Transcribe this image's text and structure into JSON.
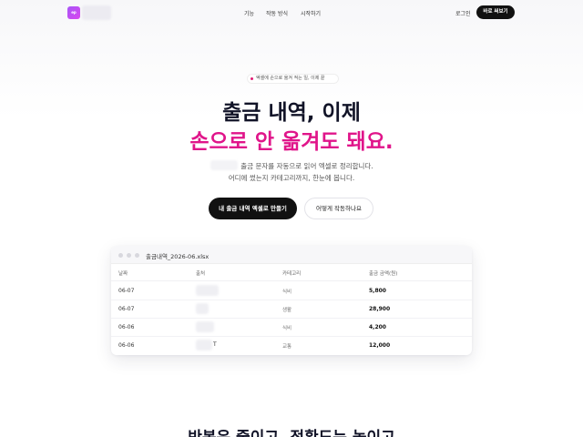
{
  "header": {
    "logo_text": "ep",
    "nav": [
      "기능",
      "작동 방식",
      "시작하기"
    ],
    "login": "로그인",
    "cta": "바로 써보기"
  },
  "hero": {
    "badge": "엑셀에 손으로 옮겨 적는 일, 이제 끝",
    "title_line1": "출금 내역, 이제",
    "title_line2": "손으로 안 옮겨도 돼요.",
    "sub_line1": "출금 문자를 자동으로 읽어 엑셀로 정리합니다.",
    "sub_line2": "어디에 썼는지 카테고리까지, 한눈에 봅니다.",
    "primary_button": "내 출금 내역 엑셀로 만들기",
    "secondary_button": "어떻게 작동하나요"
  },
  "sheet": {
    "filename": "출금내역_2026-06.xlsx",
    "columns": [
      "날짜",
      "출처",
      "카테고리",
      "출금 금액(원)"
    ],
    "rows": [
      {
        "date": "06-07",
        "category": "식비",
        "amount": "5,800",
        "tail": ""
      },
      {
        "date": "06-07",
        "category": "생활",
        "amount": "28,900",
        "tail": ""
      },
      {
        "date": "06-06",
        "category": "식비",
        "amount": "4,200",
        "tail": ""
      },
      {
        "date": "06-06",
        "category": "교통",
        "amount": "12,000",
        "tail": "T"
      }
    ]
  },
  "section": {
    "title": "반복은 줄이고, 정확도는 높이고"
  },
  "colors": {
    "accent": "#e0158a",
    "brand": "#a855f7",
    "dark": "#111111"
  }
}
